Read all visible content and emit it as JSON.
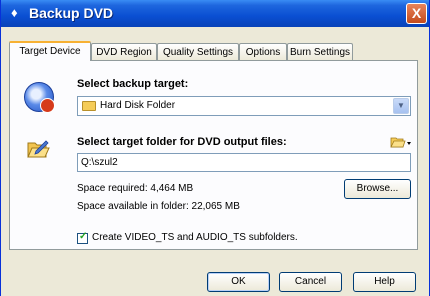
{
  "window": {
    "title": "Backup DVD",
    "close_label": "X"
  },
  "tabs": [
    {
      "label": "Target Device",
      "active": true
    },
    {
      "label": "DVD Region",
      "active": false
    },
    {
      "label": "Quality Settings",
      "active": false
    },
    {
      "label": "Options",
      "active": false
    },
    {
      "label": "Burn Settings",
      "active": false
    }
  ],
  "target": {
    "heading": "Select backup target:",
    "selected": "Hard Disk Folder"
  },
  "output": {
    "heading": "Select target folder for DVD output files:",
    "path": "Q:\\szul2",
    "space_required": "Space required:  4,464 MB",
    "space_available": "Space available in folder:  22,065 MB",
    "browse_label": "Browse..."
  },
  "subfolders": {
    "checked": true,
    "label": "Create VIDEO_TS and AUDIO_TS subfolders."
  },
  "buttons": {
    "ok": "OK",
    "cancel": "Cancel",
    "help": "Help"
  }
}
